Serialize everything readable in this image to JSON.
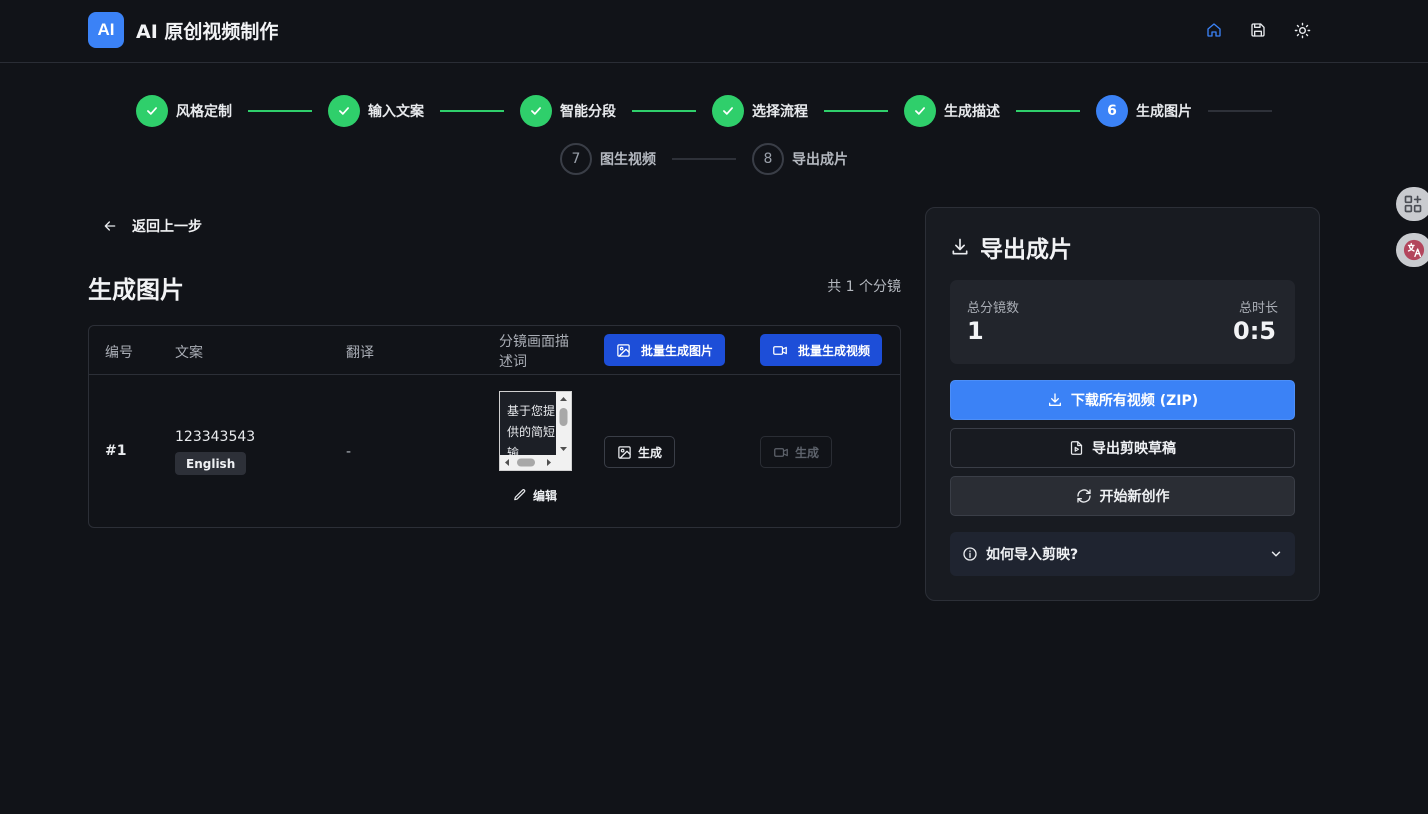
{
  "header": {
    "logo_text": "AI",
    "title": "AI 原创视频制作",
    "icons": [
      "home-icon",
      "save-icon",
      "sun-icon"
    ]
  },
  "steps": [
    {
      "number": "1",
      "label": "风格定制",
      "status": "done"
    },
    {
      "number": "2",
      "label": "输入文案",
      "status": "done"
    },
    {
      "number": "3",
      "label": "智能分段",
      "status": "done"
    },
    {
      "number": "4",
      "label": "选择流程",
      "status": "done"
    },
    {
      "number": "5",
      "label": "生成描述",
      "status": "done"
    },
    {
      "number": "6",
      "label": "生成图片",
      "status": "active"
    },
    {
      "number": "7",
      "label": "图生视频",
      "status": "todo"
    },
    {
      "number": "8",
      "label": "导出成片",
      "status": "todo"
    }
  ],
  "main": {
    "back_label": "返回上一步",
    "title": "生成图片",
    "count_text": "共 1 个分镜",
    "table": {
      "headers": {
        "number": "编号",
        "script": "文案",
        "translation": "翻译",
        "description": "分镜画面描述词"
      },
      "bulk_image_label": "批量生成图片",
      "bulk_video_label": "批量生成视频",
      "rows": [
        {
          "number": "#1",
          "script": "123343543",
          "language": "English",
          "translation": "-",
          "description": "基于您提供的简短输",
          "edit_label": "编辑",
          "gen_image_label": "生成",
          "gen_video_label": "生成"
        }
      ]
    }
  },
  "panel": {
    "title": "导出成片",
    "total_shots_label": "总分镜数",
    "total_shots_value": "1",
    "total_duration_label": "总时长",
    "total_duration_value": "0:5",
    "download_label": "下载所有视频 (ZIP)",
    "export_draft_label": "导出剪映草稿",
    "new_creation_label": "开始新创作",
    "faq_label": "如何导入剪映?"
  },
  "colors": {
    "background": "#111318",
    "accent": "#3b82f6",
    "success": "#2fcf6b",
    "bulk_button": "#1d4ed8"
  }
}
